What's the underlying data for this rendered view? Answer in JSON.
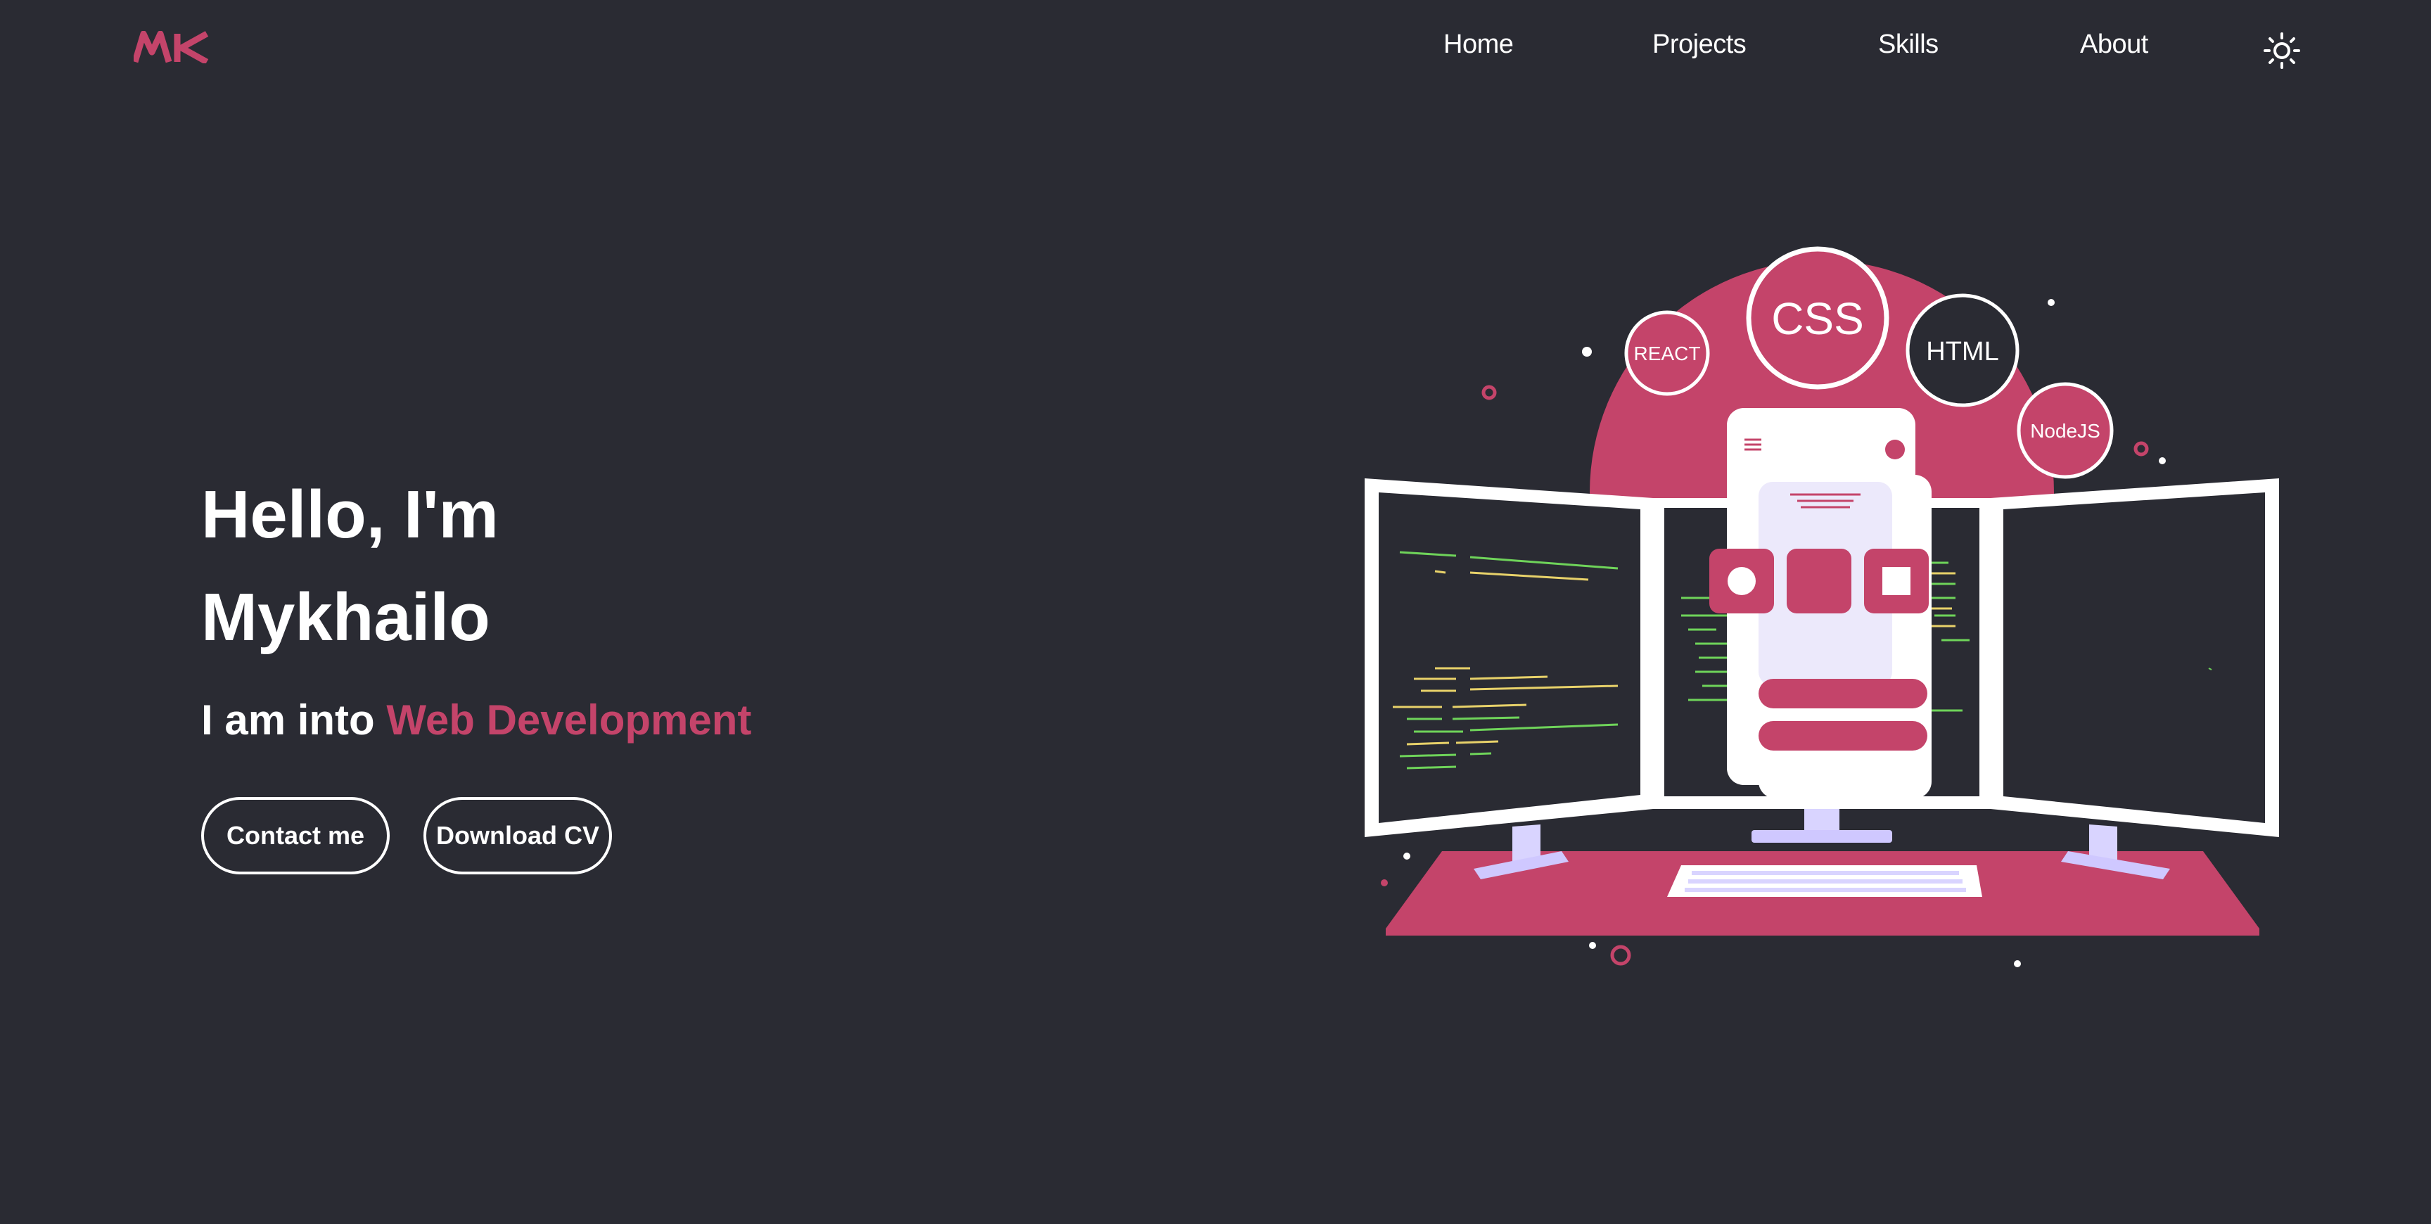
{
  "header": {
    "logo_text": "MK",
    "nav": [
      {
        "label": "Home"
      },
      {
        "label": "Projects"
      },
      {
        "label": "Skills"
      },
      {
        "label": "About"
      }
    ],
    "theme_icon": "sun-icon"
  },
  "hero": {
    "greeting": "Hello, I'm",
    "name": "Mykhailo",
    "subtitle_prefix": "I am into ",
    "subtitle_highlight": "Web Development",
    "buttons": {
      "contact": "Contact me",
      "download": "Download CV"
    }
  },
  "illustration": {
    "badges": {
      "react": "REACT",
      "css": "CSS",
      "html": "HTML",
      "nodejs": "NodeJS"
    }
  },
  "colors": {
    "background": "#2a2b33",
    "accent": "#c4446a",
    "text": "#ffffff"
  }
}
